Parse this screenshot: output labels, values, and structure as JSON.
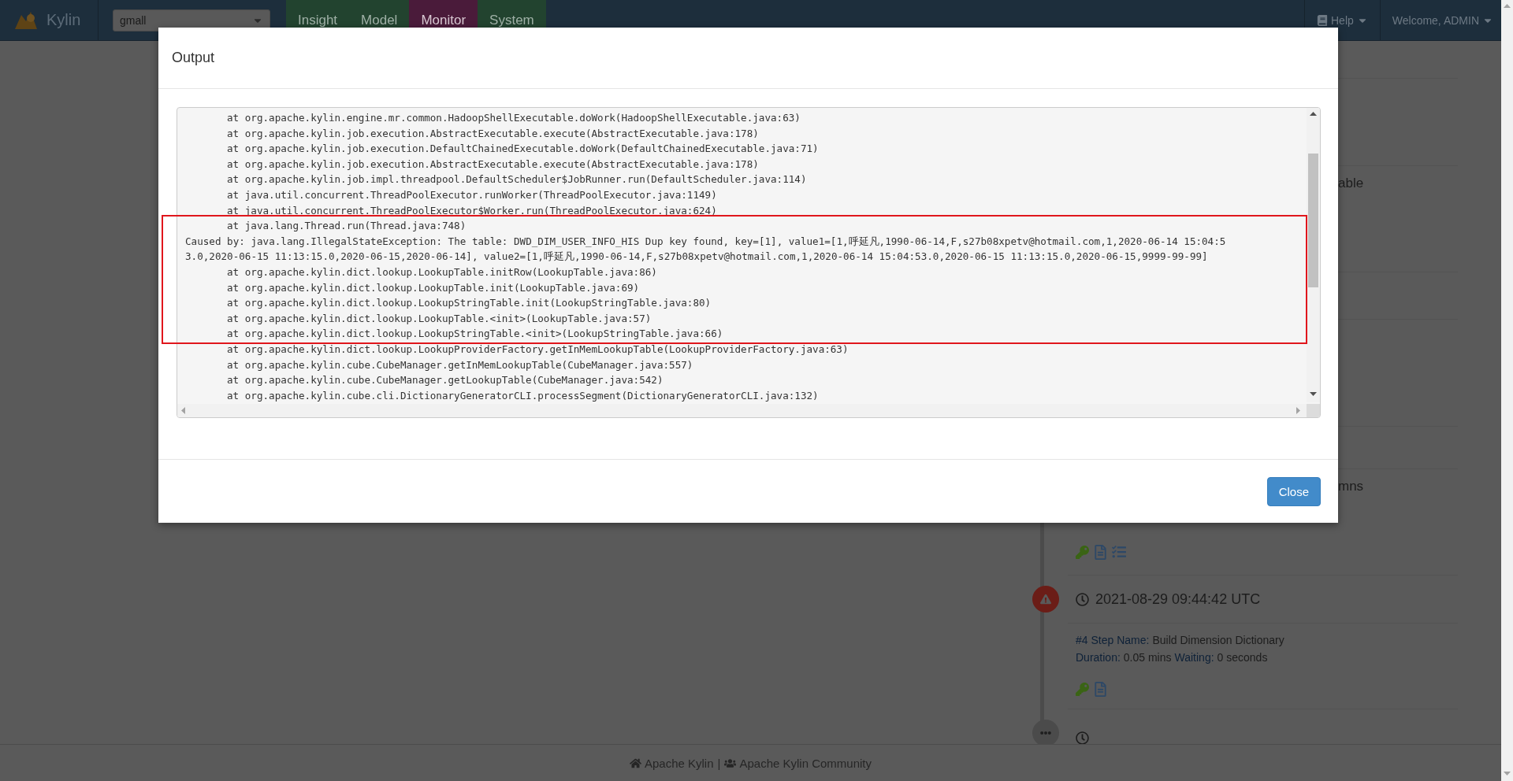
{
  "navbar": {
    "brand": "Kylin",
    "project_select": {
      "value": "gmall"
    },
    "tabs": [
      {
        "label": "Insight",
        "selected": false
      },
      {
        "label": "Model",
        "selected": false
      },
      {
        "label": "Monitor",
        "selected": true
      },
      {
        "label": "System",
        "selected": false
      }
    ],
    "help": "Help",
    "user": "Welcome, ADMIN"
  },
  "background_fragments": [
    "able",
    "mns"
  ],
  "timeline": {
    "steps": [
      {
        "kind": "error",
        "time": "2021-08-29 09:44:42 UTC",
        "step_label": "#4 Step Name:",
        "step_name": "Build Dimension Dictionary",
        "duration_label": "Duration:",
        "duration": "0.05 mins",
        "waiting_label": "Waiting:",
        "waiting": "0 seconds"
      },
      {
        "kind": "pending"
      }
    ]
  },
  "dialog": {
    "title": "Output",
    "log_lines": [
      {
        "kind": "frame",
        "text": "at org.apache.kylin.engine.mr.common.HadoopShellExecutable.doWork(HadoopShellExecutable.java:63)"
      },
      {
        "kind": "frame",
        "text": "at org.apache.kylin.job.execution.AbstractExecutable.execute(AbstractExecutable.java:178)"
      },
      {
        "kind": "frame",
        "text": "at org.apache.kylin.job.execution.DefaultChainedExecutable.doWork(DefaultChainedExecutable.java:71)"
      },
      {
        "kind": "frame",
        "text": "at org.apache.kylin.job.execution.AbstractExecutable.execute(AbstractExecutable.java:178)"
      },
      {
        "kind": "frame",
        "text": "at org.apache.kylin.job.impl.threadpool.DefaultScheduler$JobRunner.run(DefaultScheduler.java:114)"
      },
      {
        "kind": "frame",
        "text": "at java.util.concurrent.ThreadPoolExecutor.runWorker(ThreadPoolExecutor.java:1149)"
      },
      {
        "kind": "frame",
        "text": "at java.util.concurrent.ThreadPoolExecutor$Worker.run(ThreadPoolExecutor.java:624)"
      },
      {
        "kind": "frame",
        "text": "at java.lang.Thread.run(Thread.java:748)"
      },
      {
        "kind": "message",
        "text": "Caused by: java.lang.IllegalStateException: The table: DWD_DIM_USER_INFO_HIS Dup key found, key=[1], value1=[1,呼延凡,1990-06-14,F,s27b08xpetv@hotmail.com,1,2020-06-14 15:04:5"
      },
      {
        "kind": "message",
        "text": "3.0,2020-06-15 11:13:15.0,2020-06-15,2020-06-14], value2=[1,呼延凡,1990-06-14,F,s27b08xpetv@hotmail.com,1,2020-06-14 15:04:53.0,2020-06-15 11:13:15.0,2020-06-15,9999-99-99]"
      },
      {
        "kind": "frame",
        "text": "at org.apache.kylin.dict.lookup.LookupTable.initRow(LookupTable.java:86)"
      },
      {
        "kind": "frame",
        "text": "at org.apache.kylin.dict.lookup.LookupTable.init(LookupTable.java:69)"
      },
      {
        "kind": "frame",
        "text": "at org.apache.kylin.dict.lookup.LookupStringTable.init(LookupStringTable.java:80)"
      },
      {
        "kind": "frame",
        "text": "at org.apache.kylin.dict.lookup.LookupTable.<init>(LookupTable.java:57)"
      },
      {
        "kind": "frame",
        "text": "at org.apache.kylin.dict.lookup.LookupStringTable.<init>(LookupStringTable.java:66)"
      },
      {
        "kind": "frame",
        "text": "at org.apache.kylin.dict.lookup.LookupProviderFactory.getInMemLookupTable(LookupProviderFactory.java:63)"
      },
      {
        "kind": "frame",
        "text": "at org.apache.kylin.cube.CubeManager.getInMemLookupTable(CubeManager.java:557)"
      },
      {
        "kind": "frame",
        "text": "at org.apache.kylin.cube.CubeManager.getLookupTable(CubeManager.java:542)"
      },
      {
        "kind": "frame",
        "text": "at org.apache.kylin.cube.cli.DictionaryGeneratorCLI.processSegment(DictionaryGeneratorCLI.java:132)"
      }
    ],
    "close_button": "Close"
  },
  "footer": {
    "links": [
      "Apache Kylin",
      "Apache Kylin Community"
    ],
    "separator": "|"
  }
}
